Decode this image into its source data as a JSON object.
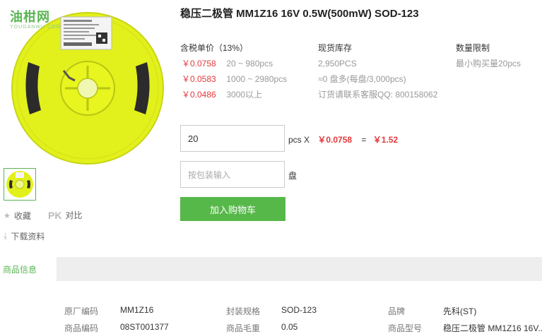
{
  "logo": {
    "main": "油柑网",
    "sub": "YOUGANWU.COM"
  },
  "product": {
    "title": "稳压二极管 MM1Z16 16V 0.5W(500mW) SOD-123"
  },
  "pricing": {
    "header": "含税单价（13%）",
    "tiers": [
      {
        "price": "￥0.0758",
        "range": "20 ~ 980pcs"
      },
      {
        "price": "￥0.0583",
        "range": "1000 ~ 2980pcs"
      },
      {
        "price": "￥0.0486",
        "range": "3000以上"
      }
    ]
  },
  "stock": {
    "header": "现货库存",
    "lines": [
      "2,950PCS",
      "≈0 盘多(每盘/3,000pcs)",
      "订货请联系客服QQ: 800158062"
    ]
  },
  "limit": {
    "header": "数量限制",
    "text": "最小购买量20pcs"
  },
  "order": {
    "qty_value": "20",
    "unit_label": "pcs X",
    "unit_price": "￥0.0758",
    "equals": "=",
    "total": "￥1.52",
    "pack_placeholder": "按包装输入",
    "pack_unit": "盘",
    "cart_button": "加入购物车"
  },
  "side": {
    "favorite": "收藏",
    "pk": "PK",
    "compare": "对比",
    "download": "下载资料"
  },
  "tabs": {
    "active": "商品信息"
  },
  "specs": [
    {
      "k1": "原厂编码",
      "v1": "MM1Z16",
      "k2": "封装规格",
      "v2": "SOD-123",
      "k3": "品牌",
      "v3": "先科(ST)"
    },
    {
      "k1": "商品编码",
      "v1": "08ST001377",
      "k2": "商品毛重",
      "v2": "0.05",
      "k3": "商品型号",
      "v3": "稳压二极管 MM1Z16 16V..."
    }
  ],
  "colors": {
    "accent_green": "#57b84a",
    "price_red": "#e4393c",
    "reel_yellow": "#e5f21a"
  }
}
